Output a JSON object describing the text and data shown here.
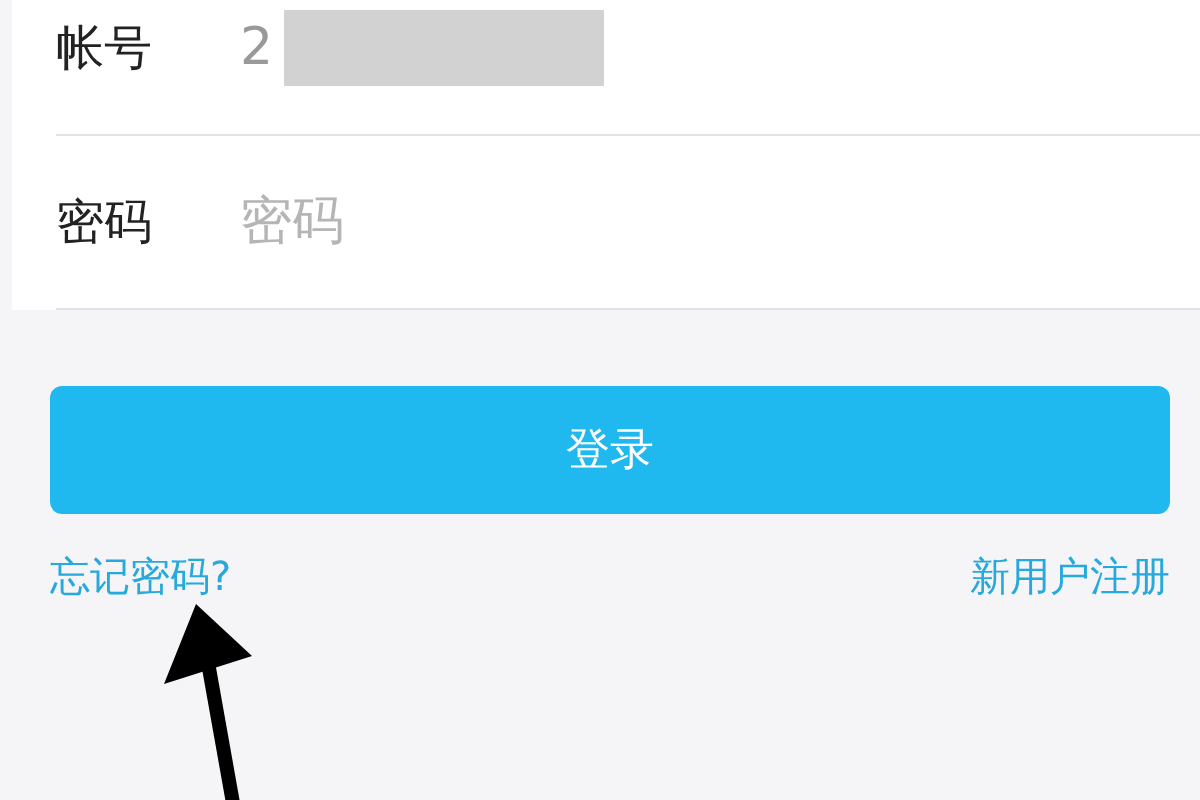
{
  "form": {
    "fields": [
      {
        "label": "帐号",
        "value": "2",
        "redacted": true
      },
      {
        "label": "密码",
        "placeholder": "密码"
      }
    ]
  },
  "login_button": "登录",
  "links": {
    "forgot_password": "忘记密码?",
    "register": "新用户注册"
  }
}
